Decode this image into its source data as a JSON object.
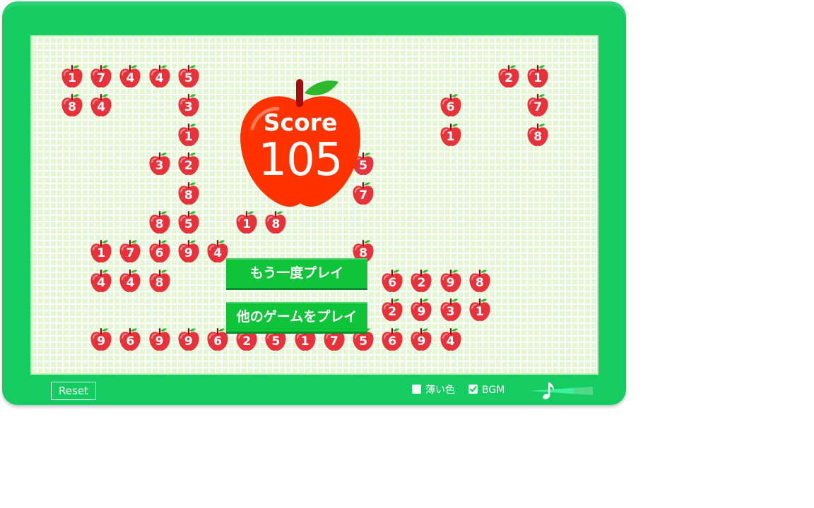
{
  "score": {
    "label": "Score",
    "value": "105"
  },
  "buttons": {
    "retry": "もう一度プレイ",
    "others": "他のゲームをプレイ"
  },
  "footer": {
    "reset": "Reset",
    "light_color": {
      "label": "薄い色",
      "checked": false
    },
    "bgm": {
      "label": "BGM",
      "checked": true
    },
    "volume_level": 0.7
  },
  "colors": {
    "frame": "#14cc62",
    "apple": "#e8323b",
    "button": "#10c43a",
    "score_apple": "#ff3300",
    "leaf": "#2eb82e"
  },
  "icons": {
    "music": "music-note-icon",
    "check": "checkbox-checked-icon"
  },
  "apples": [
    {
      "col": 0,
      "row": 0,
      "n": "1"
    },
    {
      "col": 1,
      "row": 0,
      "n": "7"
    },
    {
      "col": 2,
      "row": 0,
      "n": "4"
    },
    {
      "col": 3,
      "row": 0,
      "n": "4"
    },
    {
      "col": 4,
      "row": 0,
      "n": "5"
    },
    {
      "col": 15,
      "row": 0,
      "n": "2"
    },
    {
      "col": 16,
      "row": 0,
      "n": "1"
    },
    {
      "col": 0,
      "row": 1,
      "n": "8"
    },
    {
      "col": 1,
      "row": 1,
      "n": "4"
    },
    {
      "col": 4,
      "row": 1,
      "n": "3"
    },
    {
      "col": 13,
      "row": 1,
      "n": "6"
    },
    {
      "col": 16,
      "row": 1,
      "n": "7"
    },
    {
      "col": 4,
      "row": 2,
      "n": "1"
    },
    {
      "col": 13,
      "row": 2,
      "n": "1"
    },
    {
      "col": 16,
      "row": 2,
      "n": "8"
    },
    {
      "col": 3,
      "row": 3,
      "n": "3"
    },
    {
      "col": 4,
      "row": 3,
      "n": "2"
    },
    {
      "col": 10,
      "row": 3,
      "n": "5"
    },
    {
      "col": 4,
      "row": 4,
      "n": "8"
    },
    {
      "col": 10,
      "row": 4,
      "n": "7"
    },
    {
      "col": 3,
      "row": 5,
      "n": "8"
    },
    {
      "col": 4,
      "row": 5,
      "n": "5"
    },
    {
      "col": 6,
      "row": 5,
      "n": "1"
    },
    {
      "col": 7,
      "row": 5,
      "n": "8"
    },
    {
      "col": 1,
      "row": 6,
      "n": "1"
    },
    {
      "col": 2,
      "row": 6,
      "n": "7"
    },
    {
      "col": 3,
      "row": 6,
      "n": "6"
    },
    {
      "col": 4,
      "row": 6,
      "n": "9"
    },
    {
      "col": 5,
      "row": 6,
      "n": "4"
    },
    {
      "col": 10,
      "row": 6,
      "n": "8"
    },
    {
      "col": 1,
      "row": 7,
      "n": "4"
    },
    {
      "col": 2,
      "row": 7,
      "n": "4"
    },
    {
      "col": 3,
      "row": 7,
      "n": "8"
    },
    {
      "col": 11,
      "row": 7,
      "n": "6"
    },
    {
      "col": 12,
      "row": 7,
      "n": "2"
    },
    {
      "col": 13,
      "row": 7,
      "n": "9"
    },
    {
      "col": 14,
      "row": 7,
      "n": "8"
    },
    {
      "col": 11,
      "row": 8,
      "n": "2"
    },
    {
      "col": 12,
      "row": 8,
      "n": "9"
    },
    {
      "col": 13,
      "row": 8,
      "n": "3"
    },
    {
      "col": 14,
      "row": 8,
      "n": "1"
    },
    {
      "col": 1,
      "row": 9,
      "n": "9"
    },
    {
      "col": 2,
      "row": 9,
      "n": "6"
    },
    {
      "col": 3,
      "row": 9,
      "n": "9"
    },
    {
      "col": 4,
      "row": 9,
      "n": "9"
    },
    {
      "col": 5,
      "row": 9,
      "n": "6"
    },
    {
      "col": 6,
      "row": 9,
      "n": "2"
    },
    {
      "col": 7,
      "row": 9,
      "n": "5"
    },
    {
      "col": 8,
      "row": 9,
      "n": "1"
    },
    {
      "col": 9,
      "row": 9,
      "n": "7"
    },
    {
      "col": 10,
      "row": 9,
      "n": "5"
    },
    {
      "col": 11,
      "row": 9,
      "n": "6"
    },
    {
      "col": 12,
      "row": 9,
      "n": "9"
    },
    {
      "col": 13,
      "row": 9,
      "n": "4"
    }
  ]
}
